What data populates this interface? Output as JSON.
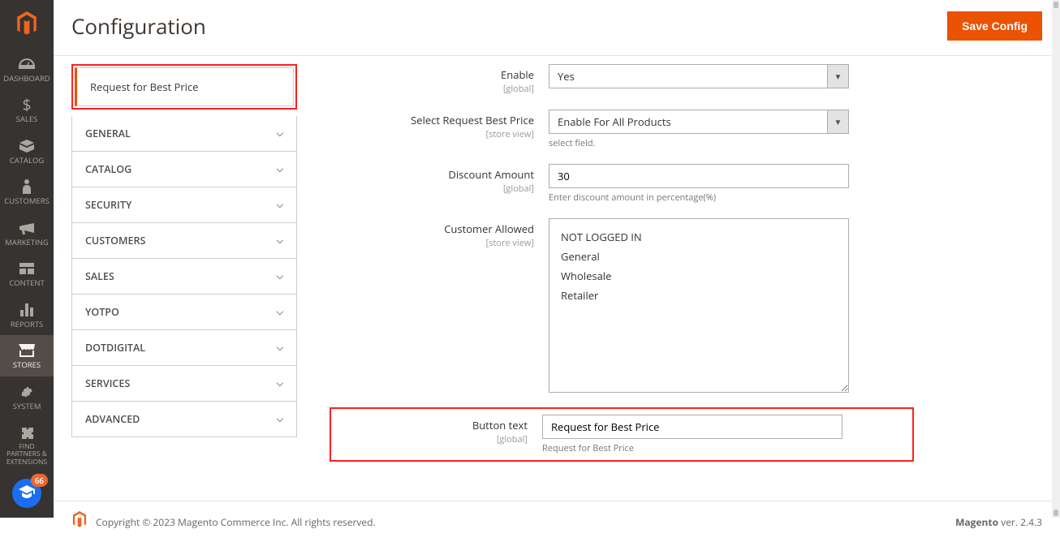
{
  "sidebar": {
    "items": [
      {
        "id": "dashboard",
        "label": "DASHBOARD"
      },
      {
        "id": "sales",
        "label": "SALES"
      },
      {
        "id": "catalog",
        "label": "CATALOG"
      },
      {
        "id": "customers",
        "label": "CUSTOMERS"
      },
      {
        "id": "marketing",
        "label": "MARKETING"
      },
      {
        "id": "content",
        "label": "CONTENT"
      },
      {
        "id": "reports",
        "label": "REPORTS"
      },
      {
        "id": "stores",
        "label": "STORES"
      },
      {
        "id": "system",
        "label": "SYSTEM"
      },
      {
        "id": "find",
        "label": "FIND PARTNERS & EXTENSIONS"
      }
    ],
    "help_badge": "66"
  },
  "header": {
    "title": "Configuration",
    "save_label": "Save Config"
  },
  "tabs": {
    "active": "Request for Best Price",
    "groups": [
      "GENERAL",
      "CATALOG",
      "SECURITY",
      "CUSTOMERS",
      "SALES",
      "YOTPO",
      "DOTDIGITAL",
      "SERVICES",
      "ADVANCED"
    ]
  },
  "form": {
    "enable": {
      "label": "Enable",
      "scope": "[global]",
      "value": "Yes"
    },
    "select_request": {
      "label": "Select Request Best Price",
      "scope": "[store view]",
      "value": "Enable For All Products",
      "hint": "select field."
    },
    "discount": {
      "label": "Discount Amount",
      "scope": "[global]",
      "value": "30",
      "hint": "Enter discount amount in percentage(%)"
    },
    "customer_allowed": {
      "label": "Customer Allowed",
      "scope": "[store view]",
      "options": [
        "NOT LOGGED IN",
        "General",
        "Wholesale",
        "Retailer"
      ]
    },
    "button_text": {
      "label": "Button text",
      "scope": "[global]",
      "value": "Request for Best Price",
      "hint": "Request for Best Price"
    }
  },
  "footer": {
    "copyright": "Copyright © 2023 Magento Commerce Inc. All rights reserved.",
    "product": "Magento",
    "version": " ver. 2.4.3"
  }
}
